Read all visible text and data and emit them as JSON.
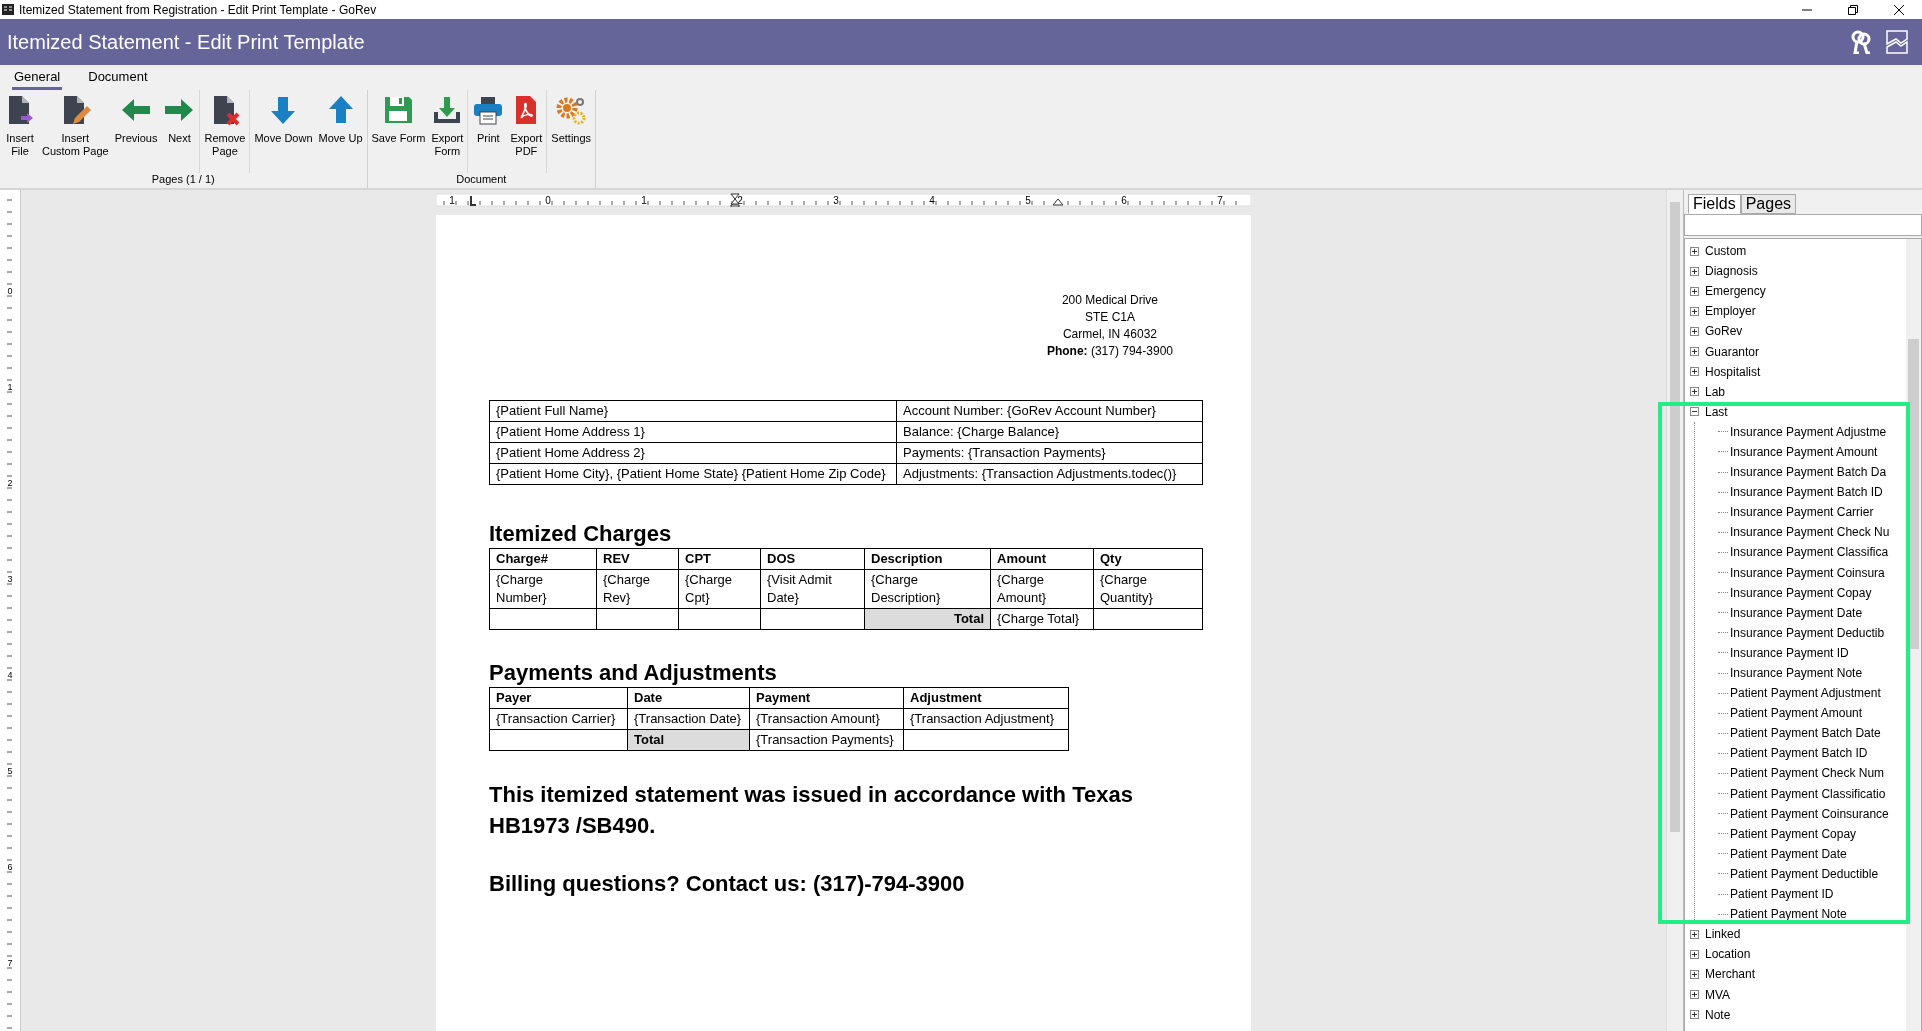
{
  "window": {
    "title": "Itemized Statement from Registration - Edit Print Template - GoRev"
  },
  "header": {
    "title": "Itemized Statement - Edit Print Template"
  },
  "ribbon_tabs": [
    {
      "label": "General",
      "selected": true
    },
    {
      "label": "Document",
      "selected": false
    }
  ],
  "ribbon_groups": [
    {
      "label": "Pages (1 / 1)",
      "clusters": [
        [
          {
            "kind": "insert_file",
            "lines": [
              "Insert",
              "File"
            ]
          },
          {
            "kind": "insert_custom",
            "lines": [
              "Insert",
              "Custom Page"
            ]
          },
          {
            "kind": "previous",
            "lines": [
              "Previous"
            ]
          },
          {
            "kind": "next",
            "lines": [
              "Next"
            ]
          }
        ],
        [
          {
            "kind": "remove",
            "lines": [
              "Remove",
              "Page"
            ]
          }
        ],
        [
          {
            "kind": "move_down",
            "lines": [
              "Move Down"
            ]
          },
          {
            "kind": "move_up",
            "lines": [
              "Move Up"
            ]
          }
        ]
      ]
    },
    {
      "label": "Document",
      "clusters": [
        [
          {
            "kind": "save",
            "lines": [
              "Save Form"
            ]
          },
          {
            "kind": "export",
            "lines": [
              "Export",
              "Form"
            ]
          }
        ],
        [
          {
            "kind": "print",
            "lines": [
              "Print"
            ]
          },
          {
            "kind": "pdf",
            "lines": [
              "Export",
              "PDF"
            ]
          }
        ],
        [
          {
            "kind": "settings",
            "lines": [
              "Settings"
            ]
          }
        ]
      ]
    }
  ],
  "ruler": {
    "horizontal_labels": [
      "1",
      "0",
      "1",
      "2",
      "3",
      "4",
      "5",
      "6",
      "7"
    ],
    "vertical_labels": [
      "0",
      "1",
      "2",
      "3",
      "4",
      "5",
      "6",
      "7"
    ]
  },
  "document": {
    "address": [
      "200 Medical Drive",
      "STE C1A",
      "Carmel, IN 46032",
      "**Phone:** (317) 794-3900"
    ],
    "info_table": [
      [
        "{Patient Full Name}",
        "Account Number: {GoRev Account Number}"
      ],
      [
        "{Patient Home Address 1}",
        "Balance: {Charge Balance}"
      ],
      [
        "{Patient Home Address 2}",
        "Payments: {Transaction Payments}"
      ],
      [
        "{Patient Home City}, {Patient Home State} {Patient Home Zip Code}",
        "Adjustments: {Transaction Adjustments.todec()}"
      ]
    ],
    "charges": {
      "heading": "Itemized Charges",
      "columns": [
        "Charge#",
        "REV",
        "CPT",
        "DOS",
        "Description",
        "Amount",
        "Qty"
      ],
      "rows": [
        [
          "{Charge Number}",
          "{Charge Rev}",
          "{Charge Cpt}",
          "{Visit Admit Date}",
          "{Charge Description}",
          "{Charge Amount}",
          "{Charge Quantity}"
        ]
      ],
      "total_row": [
        {
          "kind": "empty"
        },
        {
          "kind": "empty"
        },
        {
          "kind": "empty"
        },
        {
          "kind": "empty"
        },
        {
          "text": "Total",
          "kind": "label_right"
        },
        {
          "text": "{Charge Total}",
          "kind": "value"
        },
        {
          "kind": "empty"
        }
      ]
    },
    "payments": {
      "heading": "Payments and Adjustments",
      "columns": [
        "Payer",
        "Date",
        "Payment",
        "Adjustment"
      ],
      "rows": [
        [
          "{Transaction Carrier}",
          "{Transaction Date}",
          "{Transaction Amount}",
          "{Transaction Adjustment}"
        ]
      ],
      "total_row": [
        {
          "kind": "empty"
        },
        {
          "text": "Total",
          "kind": "label"
        },
        {
          "text": "{Transaction Payments}",
          "kind": "value"
        },
        {
          "kind": "empty"
        }
      ]
    },
    "statements": [
      "This itemized statement was issued in accordance with Texas HB1973 /SB490.",
      "Billing questions? Contact us: (317)-794-3900"
    ]
  },
  "side_panel": {
    "tabs": [
      {
        "label": "Fields",
        "selected": true
      },
      {
        "label": "Pages",
        "selected": false
      }
    ],
    "tree": [
      {
        "label": "Custom",
        "expanded": false
      },
      {
        "label": "Diagnosis",
        "expanded": false
      },
      {
        "label": "Emergency",
        "expanded": false
      },
      {
        "label": "Employer",
        "expanded": false
      },
      {
        "label": "GoRev",
        "expanded": false
      },
      {
        "label": "Guarantor",
        "expanded": false
      },
      {
        "label": "Hospitalist",
        "expanded": false
      },
      {
        "label": "Lab",
        "expanded": false
      },
      {
        "label": "Last",
        "expanded": true,
        "children": [
          {
            "label": "Insurance Payment Adjustme"
          },
          {
            "label": "Insurance Payment Amount"
          },
          {
            "label": "Insurance Payment Batch Da"
          },
          {
            "label": "Insurance Payment Batch ID"
          },
          {
            "label": "Insurance Payment Carrier"
          },
          {
            "label": "Insurance Payment Check Nu"
          },
          {
            "label": "Insurance Payment Classifica"
          },
          {
            "label": "Insurance Payment Coinsura"
          },
          {
            "label": "Insurance Payment Copay"
          },
          {
            "label": "Insurance Payment Date"
          },
          {
            "label": "Insurance Payment Deductib"
          },
          {
            "label": "Insurance Payment ID"
          },
          {
            "label": "Insurance Payment Note"
          },
          {
            "label": "Patient Payment Adjustment"
          },
          {
            "label": "Patient Payment Amount"
          },
          {
            "label": "Patient Payment Batch Date"
          },
          {
            "label": "Patient Payment Batch ID"
          },
          {
            "label": "Patient Payment Check Num"
          },
          {
            "label": "Patient Payment Classificatio"
          },
          {
            "label": "Patient Payment Coinsurance"
          },
          {
            "label": "Patient Payment Copay"
          },
          {
            "label": "Patient Payment Date"
          },
          {
            "label": "Patient Payment Deductible"
          },
          {
            "label": "Patient Payment ID"
          },
          {
            "label": "Patient Payment Note"
          }
        ]
      },
      {
        "label": "Linked",
        "expanded": false
      },
      {
        "label": "Location",
        "expanded": false
      },
      {
        "label": "Merchant",
        "expanded": false
      },
      {
        "label": "MVA",
        "expanded": false
      },
      {
        "label": "Note",
        "expanded": false
      }
    ]
  }
}
